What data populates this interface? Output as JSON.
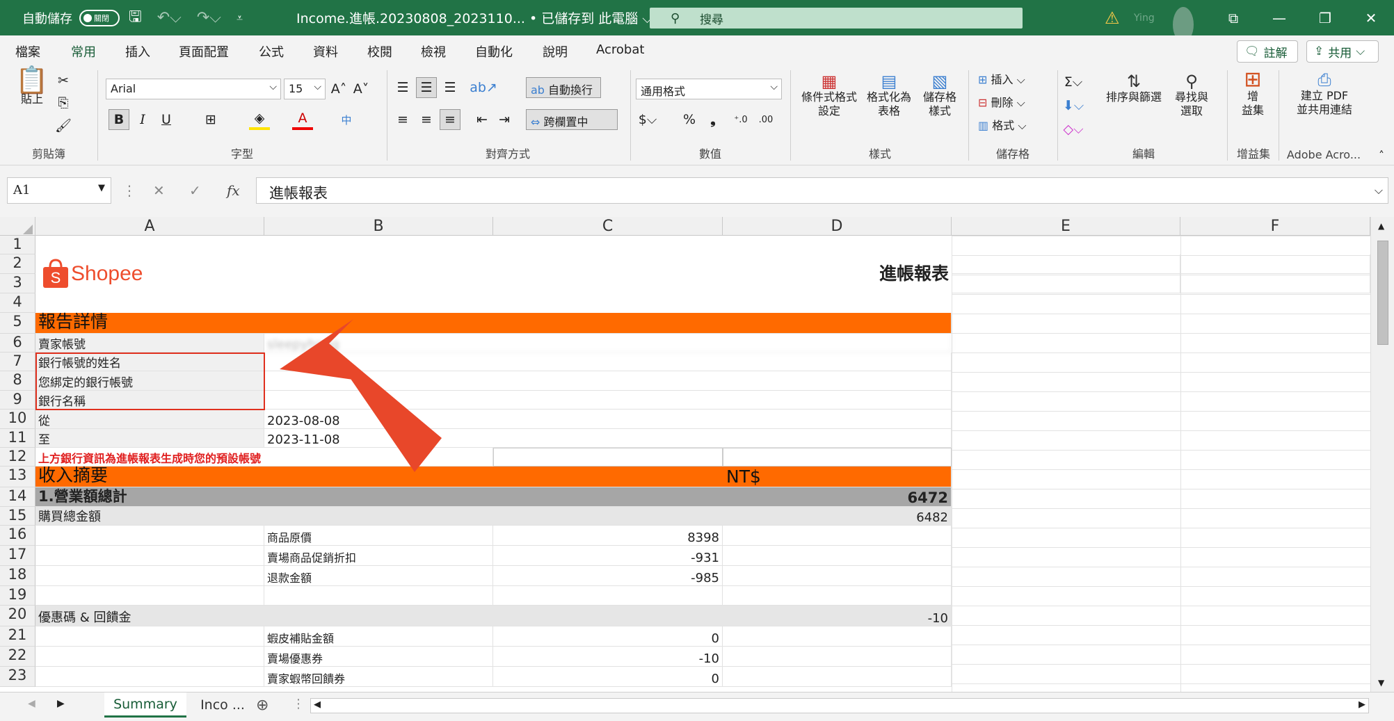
{
  "titlebar": {
    "autosave_label": "自動儲存",
    "autosave_state": "關閉",
    "doc_title": "Income.進帳.20230808_2023110... • 已儲存到 此電腦 ⌵",
    "search_placeholder": "搜尋",
    "user_name": "Ying"
  },
  "tabs": [
    "檔案",
    "常用",
    "插入",
    "頁面配置",
    "公式",
    "資料",
    "校閱",
    "檢視",
    "自動化",
    "說明",
    "Acrobat"
  ],
  "top_buttons": {
    "comments": "註解",
    "share": "共用"
  },
  "ribbon": {
    "clipboard": {
      "paste": "貼上",
      "label": "剪貼簿"
    },
    "font": {
      "name": "Arial",
      "size": "15",
      "bold": "B",
      "italic": "I",
      "underline": "U",
      "label": "字型"
    },
    "alignment": {
      "wrap": "自動換行",
      "merge": "跨欄置中",
      "label": "對齊方式"
    },
    "number": {
      "format": "通用格式",
      "label": "數值"
    },
    "styles": {
      "cond": "條件式格式\n設定",
      "table": "格式化為\n表格",
      "cell": "儲存格\n樣式",
      "label": "樣式"
    },
    "cells": {
      "insert": "插入",
      "delete": "刪除",
      "format": "格式",
      "label": "儲存格"
    },
    "editing": {
      "sort": "排序與篩選",
      "find": "尋找與\n選取",
      "label": "編輯"
    },
    "addins": {
      "addins": "增\n益集",
      "label": "增益集"
    },
    "adobe": {
      "pdf": "建立 PDF\n並共用連結",
      "label": "Adobe Acro..."
    }
  },
  "formula_bar": {
    "name_box": "A1",
    "formula": "進帳報表"
  },
  "columns": [
    "A",
    "B",
    "C",
    "D",
    "E",
    "F"
  ],
  "logo_text": "Shopee",
  "report_title": "進帳報表",
  "section_report": "報告詳情",
  "labels": {
    "seller": "賣家帳號",
    "bank_name": "銀行帳號的姓名",
    "bank_account": "您綁定的銀行帳號",
    "bank": "銀行名稱",
    "from": "從",
    "to": "至",
    "note": "上方銀行資訊為進帳報表生成時您的預設帳號"
  },
  "values": {
    "seller": "sleepyhong",
    "from": "2023-08-08",
    "to": "2023-11-08"
  },
  "section_income": "收入摘要",
  "currency": "NT$",
  "rows": {
    "total_label": "1.營業額總計",
    "total_value": "6472",
    "purchase_label": "購買總金額",
    "purchase_value": "6482",
    "item_price": "商品原價",
    "item_price_v": "8398",
    "promo": "賣場商品促銷折扣",
    "promo_v": "-931",
    "refund": "退款金額",
    "refund_v": "-985",
    "coupon_label": "優惠碼 & 回饋金",
    "coupon_value": "-10",
    "shopee_subsidy": "蝦皮補貼金額",
    "shopee_subsidy_v": "0",
    "seller_voucher": "賣場優惠券",
    "seller_voucher_v": "-10",
    "seller_coin": "賣家蝦幣回饋券",
    "seller_coin_v": "0"
  },
  "sheet_tabs": {
    "active": "Summary",
    "other": "Inco ..."
  },
  "colors": {
    "excel_green": "#217346",
    "banner_orange": "#ff6a00",
    "arrow_red": "#e8472a"
  }
}
